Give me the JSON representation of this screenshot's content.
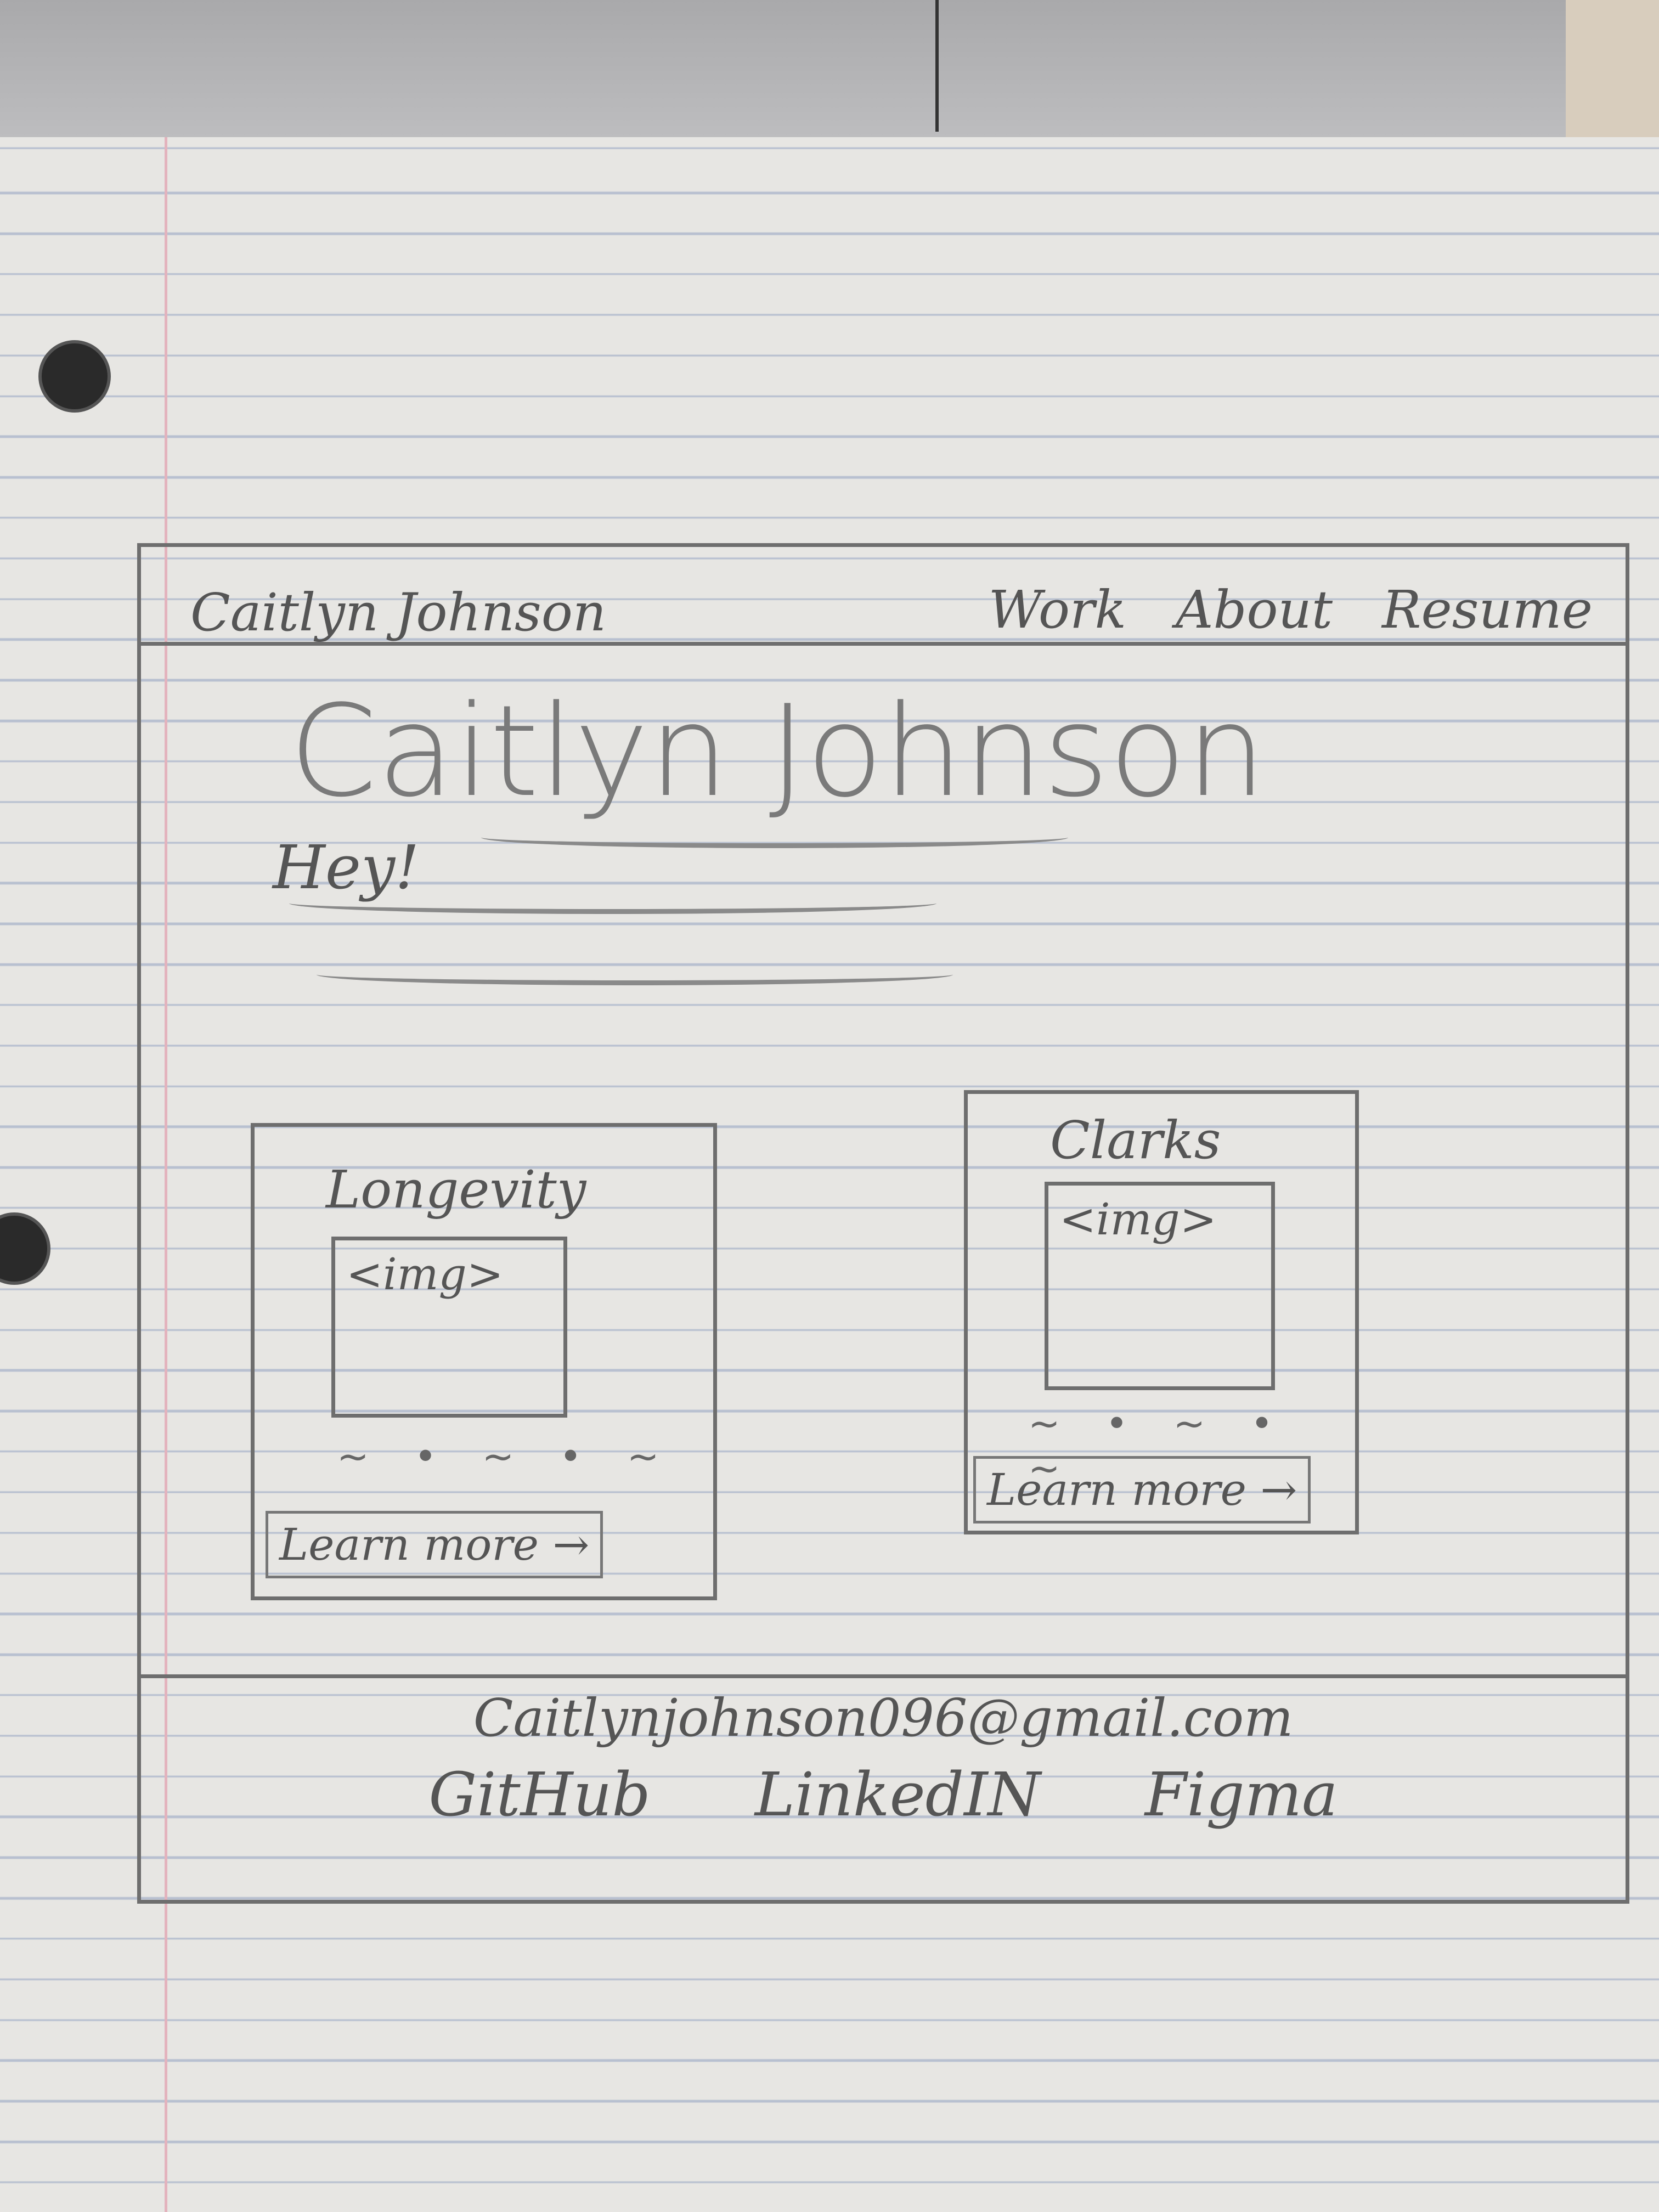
{
  "navbar": {
    "brand": "Caitlyn Johnson",
    "links": [
      "Work",
      "About",
      "Resume"
    ]
  },
  "hero": {
    "title": "Caitlyn Johnson",
    "greeting": "Hey!"
  },
  "cards": [
    {
      "title": "Longevity",
      "img_label": "<img>",
      "link": "Learn more →"
    },
    {
      "title": "Clarks",
      "img_label": "<img>",
      "link": "Learn more →"
    }
  ],
  "footer": {
    "email": "Caitlynjohnson096@gmail.com",
    "links": [
      "GitHub",
      "LinkedIN",
      "Figma"
    ]
  }
}
